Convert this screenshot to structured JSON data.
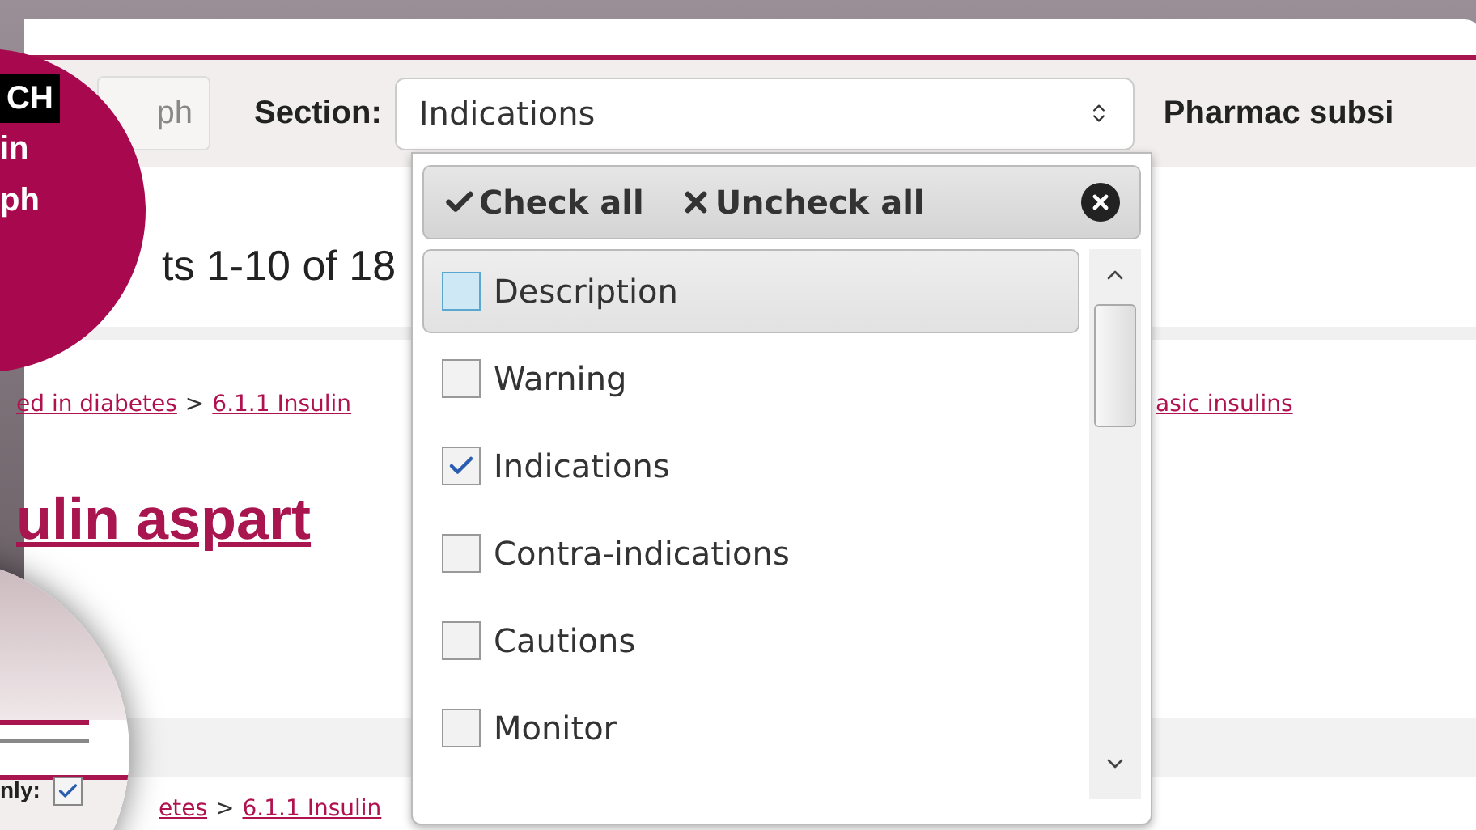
{
  "toolbar": {
    "button_label": "ph",
    "section_label": "Section:",
    "section_value": "Indications",
    "next_label": "Pharmac subsi"
  },
  "results": {
    "summary": "ts 1-10 of 18"
  },
  "breadcrumb": [
    {
      "text": "ed in diabetes",
      "kind": "link"
    },
    {
      "text": ">",
      "kind": "sep"
    },
    {
      "text": "6.1.1 Insulin",
      "kind": "link"
    },
    {
      "text": "asic insulins",
      "kind": "tail"
    }
  ],
  "result_title": "ulin aspart",
  "breadcrumb_2": [
    {
      "text": "etes",
      "kind": "link"
    },
    {
      "text": ">",
      "kind": "sep"
    },
    {
      "text": "6.1.1 Insulin",
      "kind": "link"
    }
  ],
  "dropdown": {
    "check_all": "Check all",
    "uncheck_all": "Uncheck all",
    "items": [
      {
        "label": "Description",
        "checked": false,
        "hovered": true
      },
      {
        "label": "Warning",
        "checked": false,
        "hovered": false
      },
      {
        "label": "Indications",
        "checked": true,
        "hovered": false
      },
      {
        "label": "Contra-indications",
        "checked": false,
        "hovered": false
      },
      {
        "label": "Cautions",
        "checked": false,
        "hovered": false
      },
      {
        "label": "Monitor",
        "checked": false,
        "hovered": false
      }
    ]
  },
  "callout": {
    "badge": "CH",
    "lines": [
      "in",
      "ph"
    ]
  },
  "magnifier": {
    "label": "nly:",
    "checked": true
  }
}
